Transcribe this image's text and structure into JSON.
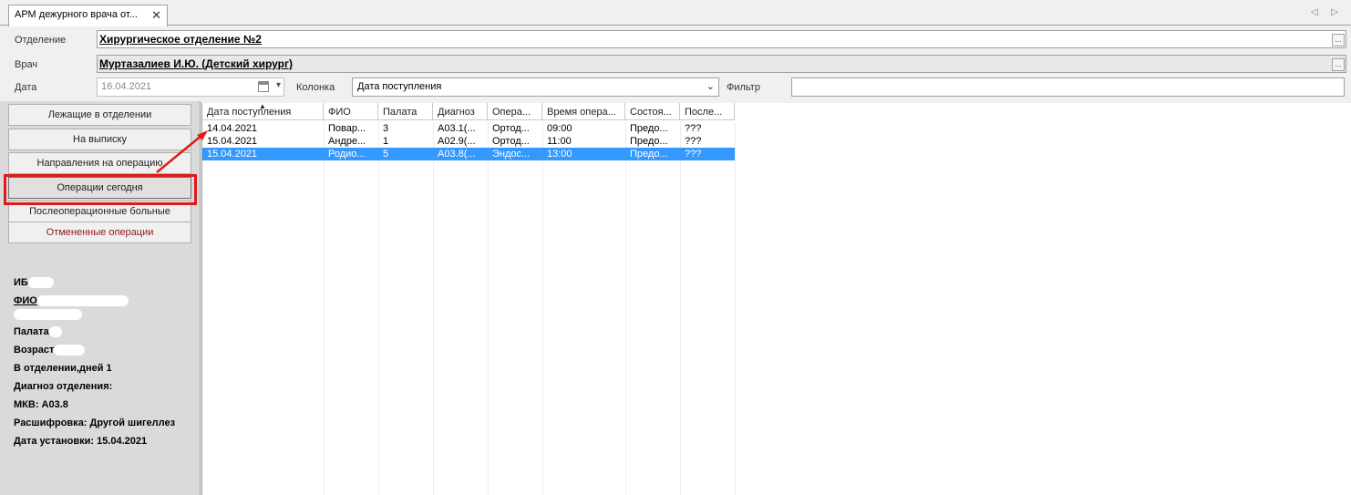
{
  "tab": {
    "title": "АРМ дежурного врача от...",
    "close": "✕",
    "nav": "◁ ▷"
  },
  "form": {
    "department_label": "Отделение",
    "department_value": "Хирургическое отделение №2",
    "doctor_label": "Врач",
    "doctor_value": "Муртазалиев И.Ю. (Детский хирург)",
    "date_label": "Дата",
    "date_value": "16.04.2021",
    "column_label": "Колонка",
    "column_value": "Дата поступления",
    "filter_label": "Фильтр",
    "filter_value": "",
    "ellipsis": "..."
  },
  "nav": {
    "items": [
      {
        "label": "Лежащие в отделении"
      },
      {
        "label": "На выписку"
      },
      {
        "label": "Направления на операцию"
      },
      {
        "label": "Операции сегодня"
      },
      {
        "label": "Послеоперационные больные"
      },
      {
        "label": "Отмененные операции"
      }
    ]
  },
  "patient": {
    "ib_label": "ИБ",
    "fio_label": "ФИО",
    "ward_label": "Палата",
    "age_label": "Возраст",
    "days_text": "В отделении,дней 1",
    "diagnosis_text": "Диагноз отделения:",
    "mkb_text": "МКВ: A03.8",
    "decode_text": "Расшифровка: Другой шигеллез",
    "date_set_text": "Дата установки: 15.04.2021"
  },
  "grid": {
    "columns": [
      "Дата поступления",
      "ФИО",
      "Палата",
      "Диагноз",
      "Опера...",
      "Время опера...",
      "Состоя...",
      "После..."
    ],
    "rows": [
      [
        "14.04.2021",
        "Повар...",
        "3",
        "A03.1(...",
        "Ортод...",
        "09:00",
        "Предо...",
        "???"
      ],
      [
        "15.04.2021",
        "Андре...",
        "1",
        "A02.9(...",
        "Ортод...",
        "11:00",
        "Предо...",
        "???"
      ],
      [
        "15.04.2021",
        "Родио...",
        "5",
        "A03.8(...",
        "Эндос...",
        "13:00",
        "Предо...",
        "???"
      ]
    ],
    "selected_row": 2
  },
  "colors": {
    "accent": "#3399ff",
    "highlight": "#e01a1a"
  }
}
